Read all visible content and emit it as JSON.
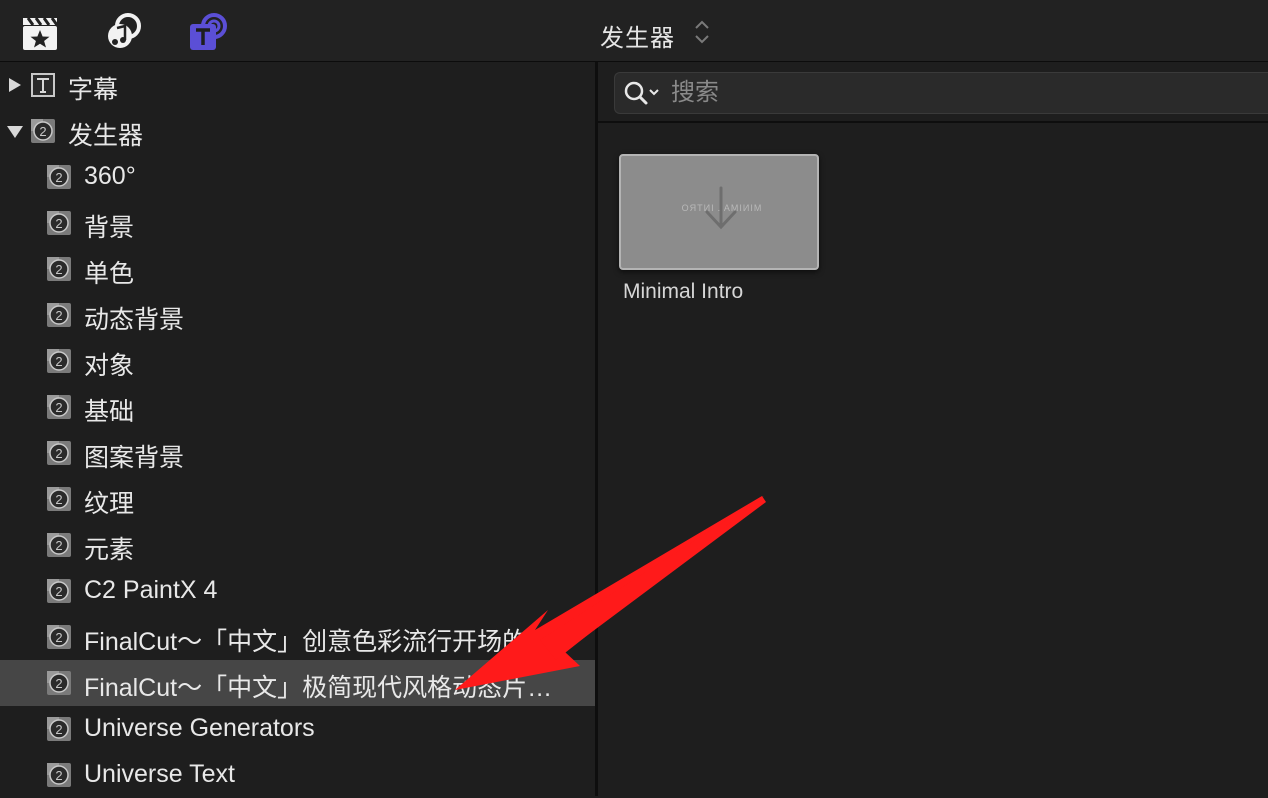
{
  "toolbar": {
    "title": "发生器",
    "icons": [
      "clapper-star-icon",
      "photos-music-icon",
      "titles-generators-icon"
    ]
  },
  "sidebar": {
    "items": [
      {
        "label": "字幕",
        "level": 0,
        "expanded": false,
        "icon": "title-t-icon"
      },
      {
        "label": "发生器",
        "level": 0,
        "expanded": true,
        "icon": "generator-icon"
      },
      {
        "label": "360°",
        "level": 1,
        "icon": "generator-icon"
      },
      {
        "label": "背景",
        "level": 1,
        "icon": "generator-icon"
      },
      {
        "label": "单色",
        "level": 1,
        "icon": "generator-icon"
      },
      {
        "label": "动态背景",
        "level": 1,
        "icon": "generator-icon"
      },
      {
        "label": "对象",
        "level": 1,
        "icon": "generator-icon"
      },
      {
        "label": "基础",
        "level": 1,
        "icon": "generator-icon"
      },
      {
        "label": "图案背景",
        "level": 1,
        "icon": "generator-icon"
      },
      {
        "label": "纹理",
        "level": 1,
        "icon": "generator-icon"
      },
      {
        "label": "元素",
        "level": 1,
        "icon": "generator-icon"
      },
      {
        "label": "C2 PaintX 4",
        "level": 1,
        "icon": "generator-icon"
      },
      {
        "label": "FinalCut～「中文」创意色彩流行开场的…",
        "level": 1,
        "icon": "generator-icon"
      },
      {
        "label": "FinalCut～「中文」极简现代风格动态片…",
        "level": 1,
        "icon": "generator-icon",
        "selected": true
      },
      {
        "label": "Universe Generators",
        "level": 1,
        "icon": "generator-icon"
      },
      {
        "label": "Universe Text",
        "level": 1,
        "icon": "generator-icon"
      }
    ]
  },
  "search": {
    "placeholder": "搜索",
    "value": ""
  },
  "content": {
    "items": [
      {
        "label": "Minimal Intro",
        "icon": "download-arrow-icon"
      }
    ]
  },
  "colors": {
    "background": "#1e1e1e",
    "toolbar": "#222222",
    "selected_row": "#464646",
    "accent_purple": "#5b4fd6",
    "annotation_red": "#ff1a1a"
  }
}
